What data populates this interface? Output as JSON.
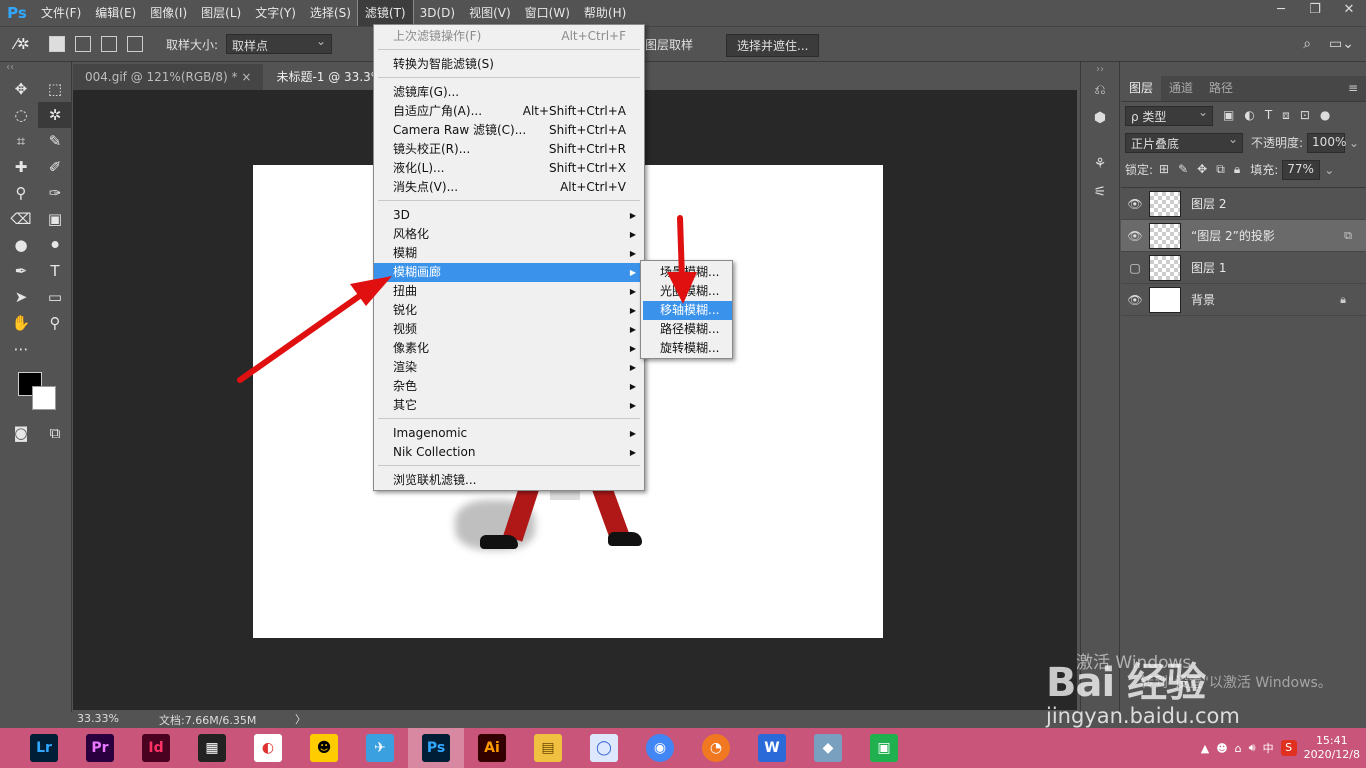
{
  "app": {
    "logo": "Ps"
  },
  "menubar": {
    "items": [
      "文件(F)",
      "编辑(E)",
      "图像(I)",
      "图层(L)",
      "文字(Y)",
      "选择(S)",
      "滤镜(T)",
      "3D(D)",
      "视图(V)",
      "窗口(W)",
      "帮助(H)"
    ],
    "active_index": 6
  },
  "window_controls": {
    "minimize": "─",
    "restore": "❐",
    "close": "✕"
  },
  "options_bar": {
    "sample_size_label": "取样大小:",
    "sample_size_value": "取样点",
    "partial_label": "图层取样",
    "select_mask_button": "选择并遮住..."
  },
  "tabs": [
    {
      "label": "004.gif @ 121%(RGB/8) *",
      "close": "×"
    },
    {
      "label": "未标题-1 @ 33.3% (\"",
      "close": ""
    }
  ],
  "status": {
    "zoom": "33.33%",
    "doc": "文档:7.66M/6.35M",
    "arrow": "〉"
  },
  "filter_menu": {
    "items": [
      {
        "label": "上次滤镜操作(F)",
        "shortcut": "Alt+Ctrl+F",
        "disabled": true
      },
      {
        "label": "转换为智能滤镜(S)",
        "shortcut": ""
      },
      {
        "label": "滤镜库(G)...",
        "shortcut": ""
      },
      {
        "label": "自适应广角(A)...",
        "shortcut": "Alt+Shift+Ctrl+A"
      },
      {
        "label": "Camera Raw 滤镜(C)...",
        "shortcut": "Shift+Ctrl+A"
      },
      {
        "label": "镜头校正(R)...",
        "shortcut": "Shift+Ctrl+R"
      },
      {
        "label": "液化(L)...",
        "shortcut": "Shift+Ctrl+X"
      },
      {
        "label": "消失点(V)...",
        "shortcut": "Alt+Ctrl+V"
      },
      {
        "label": "3D",
        "submenu": true
      },
      {
        "label": "风格化",
        "submenu": true
      },
      {
        "label": "模糊",
        "submenu": true
      },
      {
        "label": "模糊画廊",
        "submenu": true,
        "highlighted": true
      },
      {
        "label": "扭曲",
        "submenu": true
      },
      {
        "label": "锐化",
        "submenu": true
      },
      {
        "label": "视频",
        "submenu": true
      },
      {
        "label": "像素化",
        "submenu": true
      },
      {
        "label": "渲染",
        "submenu": true
      },
      {
        "label": "杂色",
        "submenu": true
      },
      {
        "label": "其它",
        "submenu": true
      },
      {
        "label": "Imagenomic",
        "submenu": true
      },
      {
        "label": "Nik Collection",
        "submenu": true
      },
      {
        "label": "浏览联机滤镜...",
        "shortcut": ""
      }
    ],
    "submenu_arrow": "▶"
  },
  "blur_gallery_submenu": {
    "items": [
      "场景模糊...",
      "光圈模糊...",
      "移轴模糊...",
      "路径模糊...",
      "旋转模糊..."
    ],
    "highlighted_index": 2
  },
  "layers_panel": {
    "tabs": [
      "图层",
      "通道",
      "路径"
    ],
    "menu_icon": "≡",
    "filter_label": "ρ 类型",
    "blend_mode": "正片叠底",
    "opacity_label": "不透明度:",
    "opacity_value": "100%",
    "lock_label": "锁定:",
    "fill_label": "填充:",
    "fill_value": "77%",
    "layers": [
      {
        "name": "图层 2",
        "visible": true,
        "thumb": "transparent"
      },
      {
        "name": "“图层 2”的投影",
        "visible": true,
        "thumb": "transparent",
        "selected": true
      },
      {
        "name": "图层 1",
        "visible": false,
        "thumb": "transparent"
      },
      {
        "name": "背景",
        "visible": true,
        "thumb": "white",
        "locked": true
      }
    ]
  },
  "watermark": {
    "activate": "激活 Windows",
    "activate_sub": "转到\"设置\"以激活 Windows。",
    "brand": "Bai 经验",
    "url": "jingyan.baidu.com"
  },
  "taskbar": {
    "apps": [
      {
        "label": "Lr",
        "color": "#31a8ff",
        "bg": "#001e36"
      },
      {
        "label": "Pr",
        "color": "#ea77ff",
        "bg": "#2a003f"
      },
      {
        "label": "Id",
        "color": "#ff3366",
        "bg": "#49021f"
      },
      {
        "label": "▦",
        "color": "#ffffff",
        "bg": "#222222"
      },
      {
        "label": "◐",
        "color": "#e03030",
        "bg": "#ffffff"
      },
      {
        "label": "☻",
        "color": "#000000",
        "bg": "#ffcc00"
      },
      {
        "label": "✈",
        "color": "#ffffff",
        "bg": "#3aa0e0"
      },
      {
        "label": "Ps",
        "color": "#31a8ff",
        "bg": "#001e36",
        "active": true
      },
      {
        "label": "Ai",
        "color": "#ff9a00",
        "bg": "#330000"
      },
      {
        "label": "▤",
        "color": "#6a4a00",
        "bg": "#f0c040"
      },
      {
        "label": "◯",
        "color": "#3060d0",
        "bg": "#dde8ff"
      },
      {
        "label": "◉",
        "color": "#ffffff",
        "bg": "#4285f4"
      },
      {
        "label": "◔",
        "color": "#ffffff",
        "bg": "#f07820"
      },
      {
        "label": "W",
        "color": "#ffffff",
        "bg": "#2a6ad8"
      },
      {
        "label": "◆",
        "color": "#ffffff",
        "bg": "#7aa0c0"
      },
      {
        "label": "▣",
        "color": "#ffffff",
        "bg": "#20b050"
      }
    ],
    "tray_input": "中",
    "time": "15:41",
    "date": "2020/12/8"
  }
}
